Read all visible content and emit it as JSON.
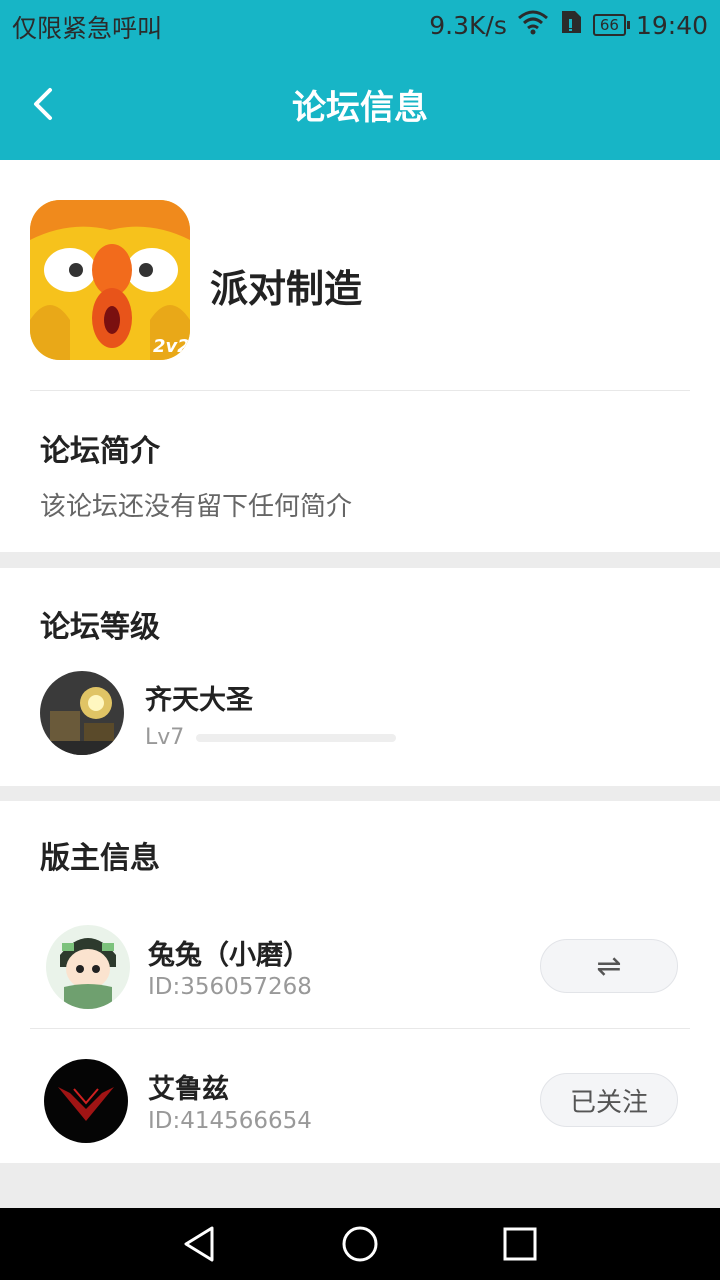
{
  "status_bar": {
    "carrier": "仅限紧急呼叫",
    "speed": "9.3K/s",
    "battery": "66",
    "time": "19:40",
    "icons": [
      "wifi-icon",
      "sim-icon"
    ]
  },
  "app_bar": {
    "title": "论坛信息",
    "back_icon": "back-arrow-icon",
    "color": "#17b5c6"
  },
  "forum": {
    "name": "派对制造",
    "icon_badge": "2v2",
    "intro_title": "论坛简介",
    "intro_text": "该论坛还没有留下任何简介"
  },
  "level": {
    "title": "论坛等级",
    "user_name": "齐天大圣",
    "level_text": "Lv7",
    "progress": 0.0
  },
  "moderators": {
    "title": "版主信息",
    "items": [
      {
        "name": "兔兔（小磨）",
        "id": "ID:356057268",
        "action": "⇌",
        "action_icon": "swap-icon"
      },
      {
        "name": "艾鲁兹",
        "id": "ID:414566654",
        "action": "已关注"
      }
    ]
  },
  "nav_bar": {
    "icons": [
      "back-triangle-icon",
      "home-circle-icon",
      "recents-square-icon"
    ]
  }
}
